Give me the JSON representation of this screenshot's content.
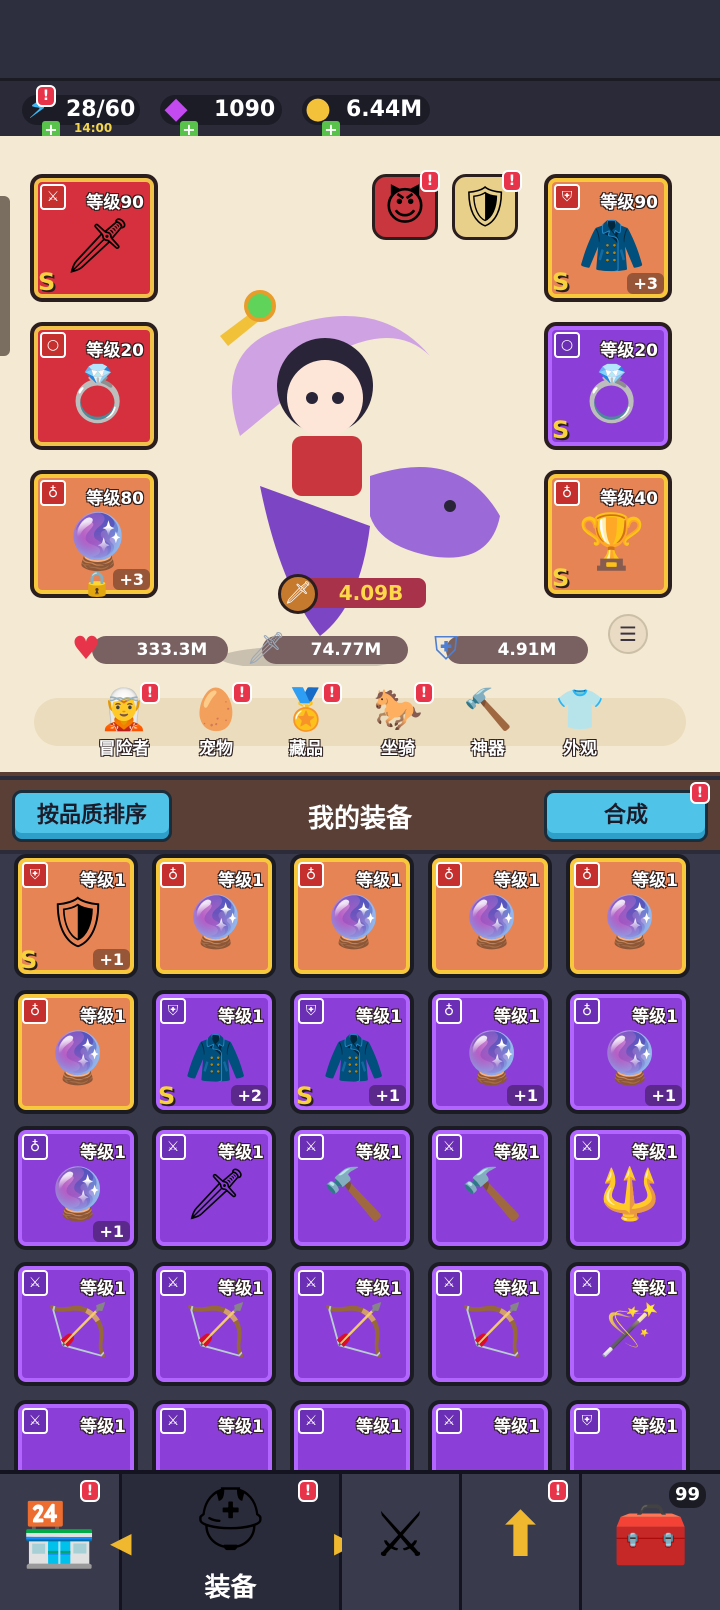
{
  "resources": {
    "energy": {
      "value": "28/60",
      "timer": "14:00",
      "icon": "lightning-icon"
    },
    "gems": {
      "value": "1090",
      "icon": "gem-icon"
    },
    "coins": {
      "value": "6.44M",
      "icon": "coin-icon"
    }
  },
  "equipped": {
    "left": [
      {
        "level": "等级90",
        "grade": "S",
        "icon": "sword-icon",
        "glyph": "🗡",
        "color": "red",
        "plus": ""
      },
      {
        "level": "等级20",
        "grade": "",
        "icon": "ring-icon",
        "glyph": "💍",
        "color": "red",
        "plus": ""
      },
      {
        "level": "等级80",
        "grade": "",
        "icon": "orb-icon",
        "glyph": "🔮",
        "color": "orange",
        "plus": "+3"
      }
    ],
    "right": [
      {
        "level": "等级90",
        "grade": "S",
        "icon": "cloak-icon",
        "glyph": "🧥",
        "color": "orange",
        "plus": "+3"
      },
      {
        "level": "等级20",
        "grade": "S",
        "icon": "ring-icon",
        "glyph": "💍",
        "color": "purple",
        "plus": ""
      },
      {
        "level": "等级40",
        "grade": "S",
        "icon": "chalice-icon",
        "glyph": "🏆",
        "color": "orange",
        "plus": ""
      }
    ]
  },
  "power": "4.09B",
  "stats": {
    "hp": "333.3M",
    "attack": "74.77M",
    "defense": "4.91M"
  },
  "nav": [
    {
      "label": "冒险者",
      "icon": "adventurer-icon",
      "glyph": "🧝"
    },
    {
      "label": "宠物",
      "icon": "pet-egg-icon",
      "glyph": "🥚"
    },
    {
      "label": "藏品",
      "icon": "collection-icon",
      "glyph": "🏅"
    },
    {
      "label": "坐骑",
      "icon": "mount-icon",
      "glyph": "🐎"
    },
    {
      "label": "神器",
      "icon": "artifact-hammer-icon",
      "glyph": "🔨"
    },
    {
      "label": "外观",
      "icon": "outfit-icon",
      "glyph": "👕"
    }
  ],
  "equip_section": {
    "sort_label": "按品质排序",
    "title": "我的装备",
    "merge_label": "合成"
  },
  "inventory": [
    {
      "level": "等级1",
      "color": "orange",
      "glyph": "🛡",
      "icon": "armor-icon",
      "grade": "S",
      "plus": "+1"
    },
    {
      "level": "等级1",
      "color": "orange",
      "glyph": "🔮",
      "icon": "orb-icon",
      "grade": "",
      "plus": ""
    },
    {
      "level": "等级1",
      "color": "orange",
      "glyph": "🔮",
      "icon": "orb-icon",
      "grade": "",
      "plus": ""
    },
    {
      "level": "等级1",
      "color": "orange",
      "glyph": "🔮",
      "icon": "orb-icon",
      "grade": "",
      "plus": ""
    },
    {
      "level": "等级1",
      "color": "orange",
      "glyph": "🔮",
      "icon": "orb-icon",
      "grade": "",
      "plus": ""
    },
    {
      "level": "等级1",
      "color": "orange",
      "glyph": "🔮",
      "icon": "orb-icon",
      "grade": "",
      "plus": ""
    },
    {
      "level": "等级1",
      "color": "purple",
      "glyph": "🧥",
      "icon": "cloak-icon",
      "grade": "S",
      "plus": "+2"
    },
    {
      "level": "等级1",
      "color": "purple",
      "glyph": "🧥",
      "icon": "cloak-icon",
      "grade": "S",
      "plus": "+1"
    },
    {
      "level": "等级1",
      "color": "purple",
      "glyph": "🔮",
      "icon": "orb-icon",
      "grade": "",
      "plus": "+1"
    },
    {
      "level": "等级1",
      "color": "purple",
      "glyph": "🔮",
      "icon": "orb-icon",
      "grade": "",
      "plus": "+1"
    },
    {
      "level": "等级1",
      "color": "purple",
      "glyph": "🔮",
      "icon": "orb-icon",
      "grade": "",
      "plus": "+1"
    },
    {
      "level": "等级1",
      "color": "purple",
      "glyph": "🗡",
      "icon": "sword-icon",
      "grade": "",
      "plus": ""
    },
    {
      "level": "等级1",
      "color": "purple",
      "glyph": "🔨",
      "icon": "hammer-icon",
      "grade": "",
      "plus": ""
    },
    {
      "level": "等级1",
      "color": "purple",
      "glyph": "🔨",
      "icon": "hammer-icon",
      "grade": "",
      "plus": ""
    },
    {
      "level": "等级1",
      "color": "purple",
      "glyph": "🔱",
      "icon": "spear-icon",
      "grade": "",
      "plus": ""
    },
    {
      "level": "等级1",
      "color": "purple",
      "glyph": "🏹",
      "icon": "crossbow-icon",
      "grade": "",
      "plus": ""
    },
    {
      "level": "等级1",
      "color": "purple",
      "glyph": "🏹",
      "icon": "crossbow-icon",
      "grade": "",
      "plus": ""
    },
    {
      "level": "等级1",
      "color": "purple",
      "glyph": "🏹",
      "icon": "crossbow-icon",
      "grade": "",
      "plus": ""
    },
    {
      "level": "等级1",
      "color": "purple",
      "glyph": "🏹",
      "icon": "crossbow-icon",
      "grade": "",
      "plus": ""
    },
    {
      "level": "等级1",
      "color": "purple",
      "glyph": "🪄",
      "icon": "staff-icon",
      "grade": "",
      "plus": ""
    },
    {
      "level": "等级1",
      "color": "purple",
      "glyph": "",
      "icon": "sword-icon",
      "grade": "",
      "plus": ""
    },
    {
      "level": "等级1",
      "color": "purple",
      "glyph": "",
      "icon": "sword-icon",
      "grade": "",
      "plus": ""
    },
    {
      "level": "等级1",
      "color": "purple",
      "glyph": "",
      "icon": "sword-icon",
      "grade": "",
      "plus": ""
    },
    {
      "level": "等级1",
      "color": "purple",
      "glyph": "",
      "icon": "sword-icon",
      "grade": "",
      "plus": ""
    },
    {
      "level": "等级1",
      "color": "purple",
      "glyph": "",
      "icon": "armor-icon",
      "grade": "",
      "plus": ""
    }
  ],
  "bottom_nav": [
    {
      "icon": "shop-icon",
      "glyph": "🏪"
    },
    {
      "icon": "helmet-icon",
      "glyph": "⛑",
      "label": "装备",
      "active": true
    },
    {
      "icon": "crossed-swords-icon",
      "glyph": "⚔"
    },
    {
      "icon": "upgrade-arrow-icon",
      "glyph": "⬆"
    },
    {
      "icon": "treasure-chest-icon",
      "glyph": "🧰",
      "badge": "99"
    }
  ]
}
